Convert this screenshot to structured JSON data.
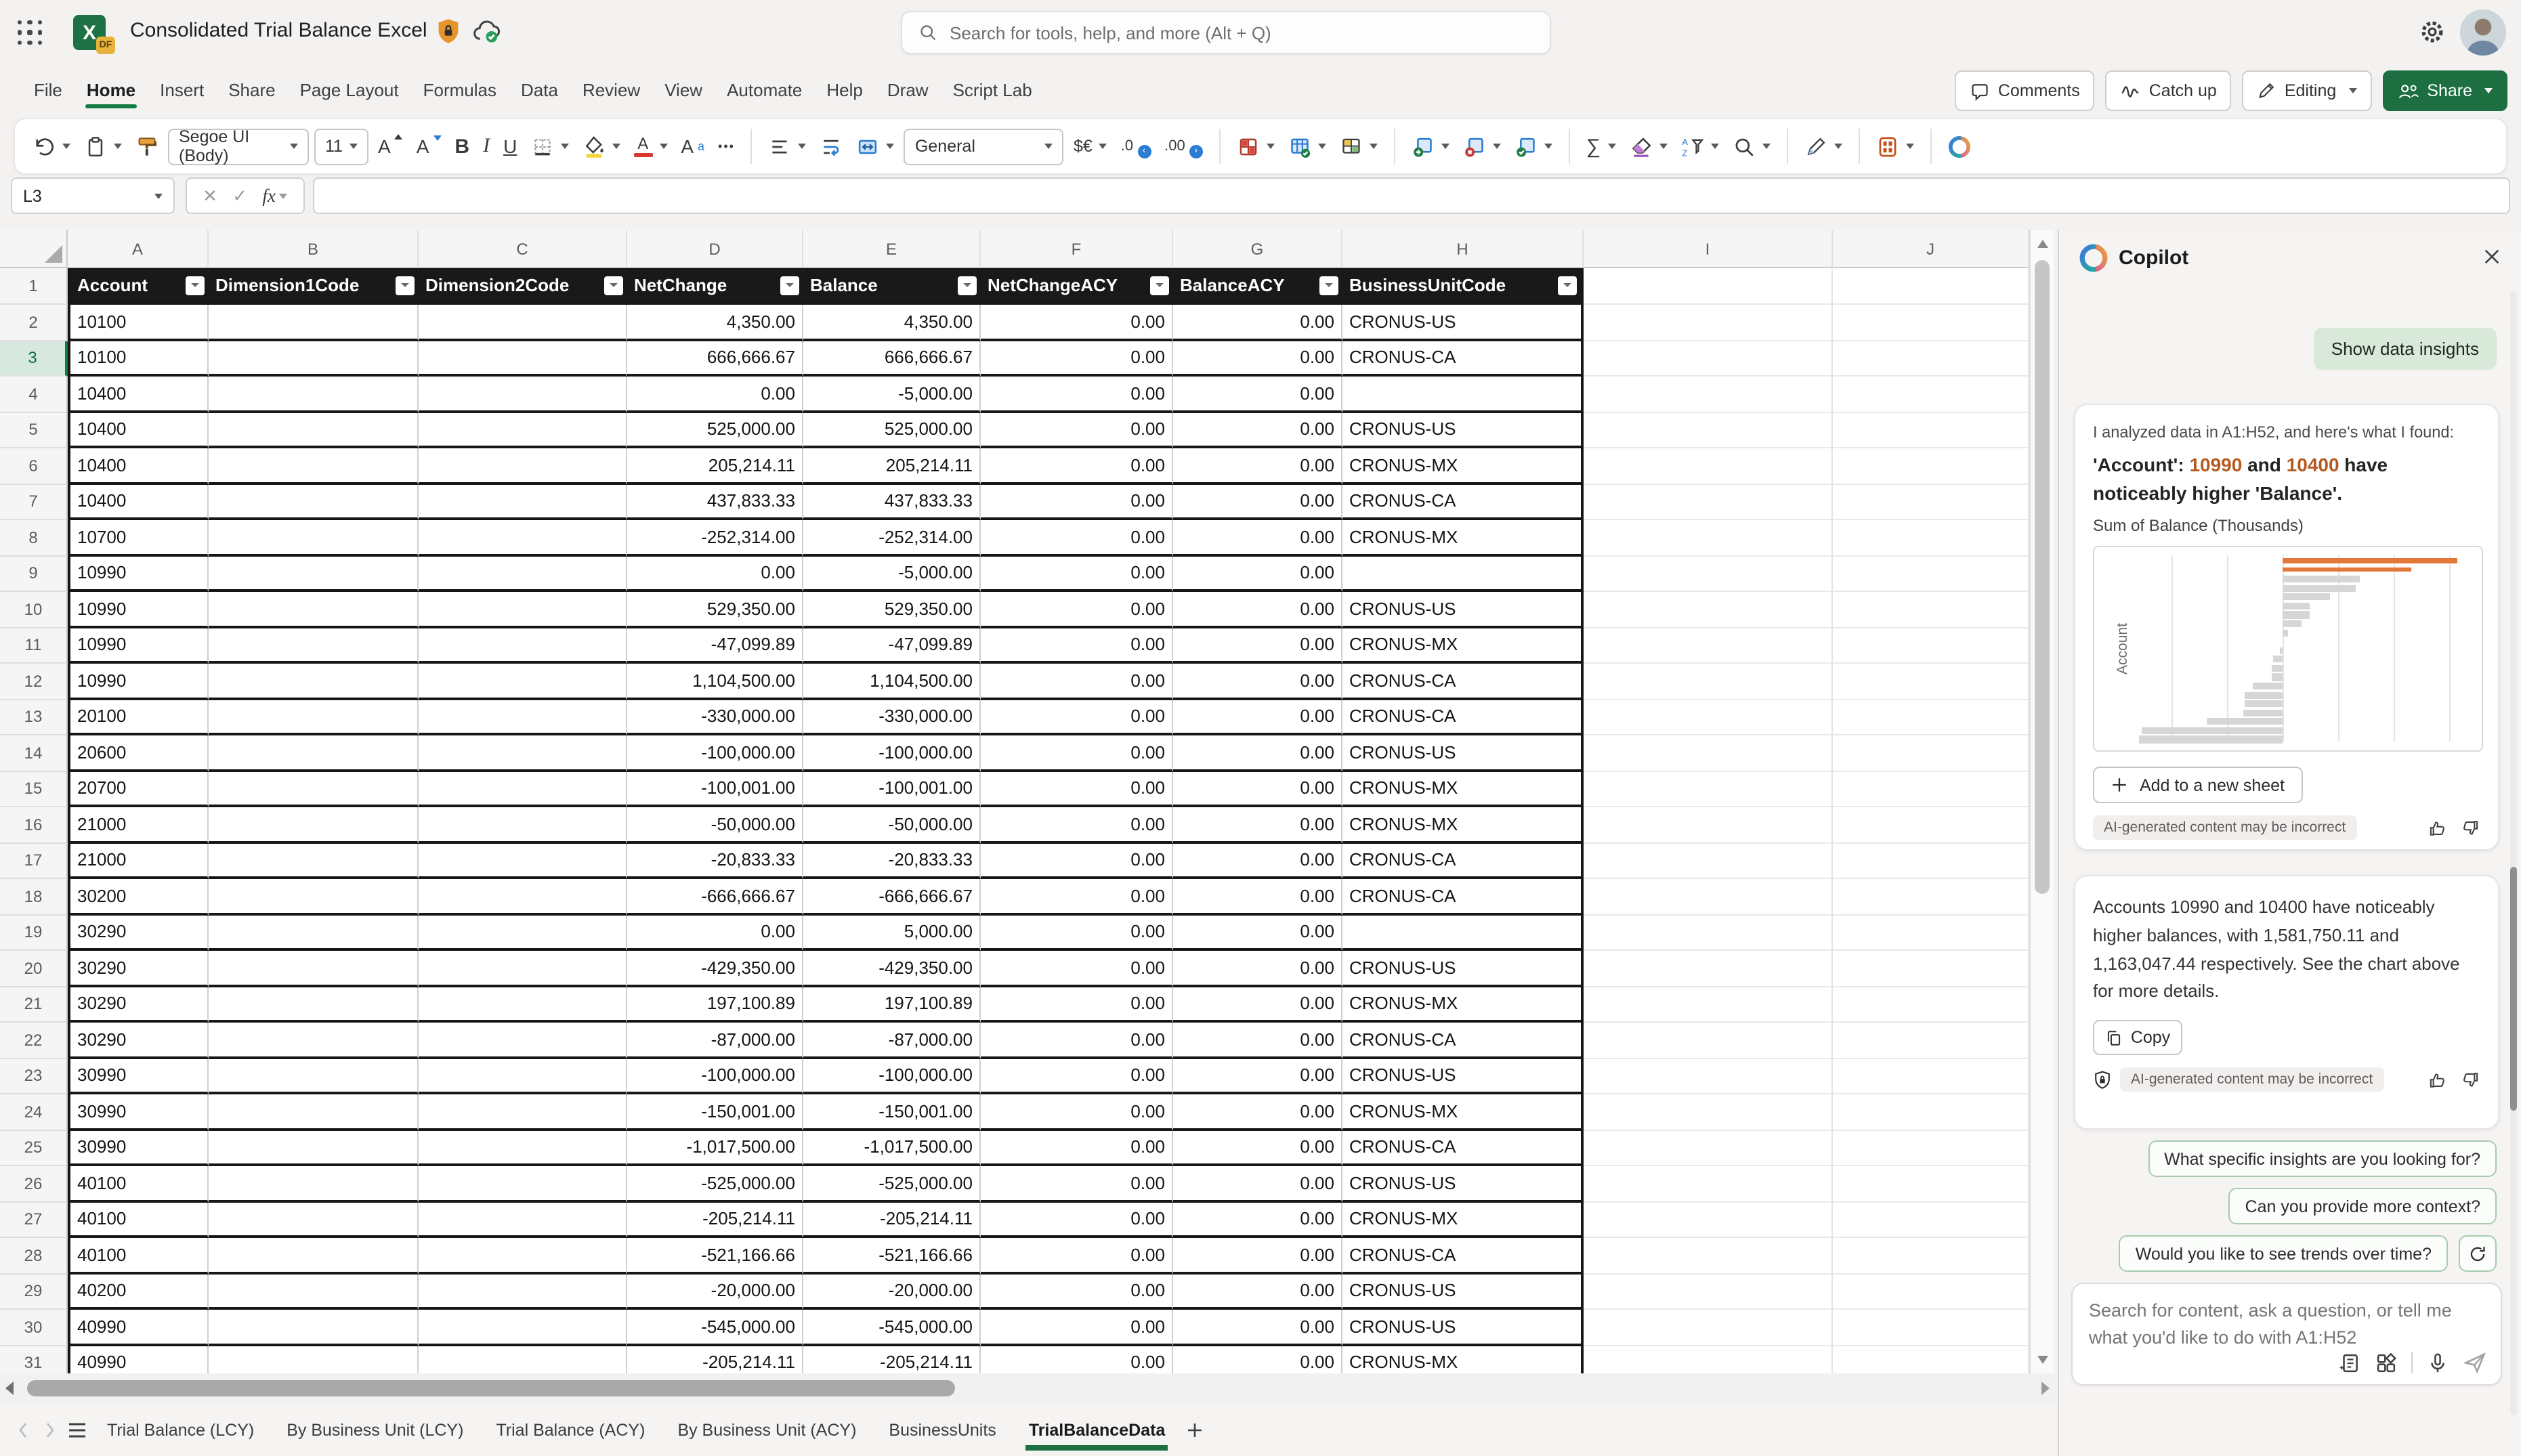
{
  "titlebar": {
    "title": "Consolidated Trial Balance Excel",
    "file_badge": "DF",
    "search_placeholder": "Search for tools, help, and more (Alt + Q)"
  },
  "menubar": {
    "items": [
      "File",
      "Home",
      "Insert",
      "Share",
      "Page Layout",
      "Formulas",
      "Data",
      "Review",
      "View",
      "Automate",
      "Help",
      "Draw",
      "Script Lab"
    ],
    "active": "Home",
    "comments_label": "Comments",
    "catchup_label": "Catch up",
    "editing_label": "Editing",
    "share_label": "Share"
  },
  "toolbar": {
    "font_name": "Segoe UI (Body)",
    "font_size": "11",
    "number_format": "General",
    "items": [
      {
        "type": "icon",
        "name": "undo",
        "caret": true
      },
      {
        "type": "icon",
        "name": "clipboard",
        "caret": true
      },
      {
        "type": "icon",
        "name": "format-painter"
      },
      {
        "type": "box",
        "name": "font-name",
        "bind": "font_name",
        "width": 104
      },
      {
        "type": "box",
        "name": "font-size",
        "bind": "font_size",
        "width": 40
      },
      {
        "type": "glyph",
        "name": "font-increase",
        "glyph": "A"
      },
      {
        "type": "glyph",
        "name": "font-decrease",
        "glyph": "A"
      },
      {
        "type": "glyph",
        "name": "bold",
        "glyph": "B"
      },
      {
        "type": "glyph",
        "name": "italic",
        "glyph": "I"
      },
      {
        "type": "glyph",
        "name": "underline",
        "glyph": "U"
      },
      {
        "type": "icon",
        "name": "borders",
        "caret": true
      },
      {
        "type": "icon",
        "name": "fill-color",
        "caret": true
      },
      {
        "type": "glyph",
        "name": "font-color",
        "glyph": "A",
        "caret": true
      },
      {
        "type": "glyph",
        "name": "text-effects",
        "glyph": "A",
        "sup": "a"
      },
      {
        "type": "glyph",
        "name": "more-formatting",
        "glyph": "•••"
      },
      {
        "type": "divider"
      },
      {
        "type": "icon",
        "name": "align",
        "caret": true
      },
      {
        "type": "icon",
        "name": "wrap-text"
      },
      {
        "type": "icon",
        "name": "merge-center",
        "caret": true
      },
      {
        "type": "box",
        "name": "number-format",
        "bind": "number_format",
        "width": 118
      },
      {
        "type": "glyph",
        "name": "currency-format",
        "glyph": "$€",
        "caret": true
      },
      {
        "type": "glyph",
        "name": "decrease-decimal",
        "glyph": ".0"
      },
      {
        "type": "glyph",
        "name": "increase-decimal",
        "glyph": ".00"
      },
      {
        "type": "divider"
      },
      {
        "type": "icon",
        "name": "conditional-formatting",
        "caret": true
      },
      {
        "type": "icon",
        "name": "format-as-table",
        "caret": true
      },
      {
        "type": "icon",
        "name": "cell-styles",
        "caret": true
      },
      {
        "type": "divider"
      },
      {
        "type": "icon",
        "name": "insert-cells",
        "caret": true
      },
      {
        "type": "icon",
        "name": "delete-cells",
        "caret": true
      },
      {
        "type": "icon",
        "name": "format-cells",
        "caret": true
      },
      {
        "type": "divider"
      },
      {
        "type": "glyph",
        "name": "autosum",
        "glyph": "∑",
        "caret": true
      },
      {
        "type": "icon",
        "name": "clear",
        "caret": true
      },
      {
        "type": "icon",
        "name": "sort-filter",
        "caret": true
      },
      {
        "type": "icon",
        "name": "find",
        "caret": true
      },
      {
        "type": "divider"
      },
      {
        "type": "icon",
        "name": "draw-tool",
        "caret": true
      },
      {
        "type": "divider"
      },
      {
        "type": "icon",
        "name": "sheet-views",
        "caret": true
      },
      {
        "type": "divider"
      },
      {
        "type": "icon",
        "name": "copilot"
      },
      {
        "type": "spacer"
      },
      {
        "type": "glyph",
        "name": "ribbon-collapse",
        "glyph": ""
      }
    ]
  },
  "formula_bar": {
    "name_box": "L3",
    "fx_label": "fx",
    "formula": ""
  },
  "grid": {
    "columns": [
      "A",
      "B",
      "C",
      "D",
      "E",
      "F",
      "G",
      "H",
      "I",
      "J"
    ],
    "table_headers": [
      "Account",
      "Dimension1Code",
      "Dimension2Code",
      "NetChange",
      "Balance",
      "NetChangeACY",
      "BalanceACY",
      "BusinessUnitCode"
    ],
    "selected_row": 3,
    "rows": [
      {
        "n": 2,
        "account": "10100",
        "net_change": "4,350.00",
        "balance": "4,350.00",
        "net_change_acy": "0.00",
        "balance_acy": "0.00",
        "business_unit": "CRONUS-US"
      },
      {
        "n": 3,
        "account": "10100",
        "net_change": "666,666.67",
        "balance": "666,666.67",
        "net_change_acy": "0.00",
        "balance_acy": "0.00",
        "business_unit": "CRONUS-CA"
      },
      {
        "n": 4,
        "account": "10400",
        "net_change": "0.00",
        "balance": "-5,000.00",
        "net_change_acy": "0.00",
        "balance_acy": "0.00",
        "business_unit": ""
      },
      {
        "n": 5,
        "account": "10400",
        "net_change": "525,000.00",
        "balance": "525,000.00",
        "net_change_acy": "0.00",
        "balance_acy": "0.00",
        "business_unit": "CRONUS-US"
      },
      {
        "n": 6,
        "account": "10400",
        "net_change": "205,214.11",
        "balance": "205,214.11",
        "net_change_acy": "0.00",
        "balance_acy": "0.00",
        "business_unit": "CRONUS-MX"
      },
      {
        "n": 7,
        "account": "10400",
        "net_change": "437,833.33",
        "balance": "437,833.33",
        "net_change_acy": "0.00",
        "balance_acy": "0.00",
        "business_unit": "CRONUS-CA"
      },
      {
        "n": 8,
        "account": "10700",
        "net_change": "-252,314.00",
        "balance": "-252,314.00",
        "net_change_acy": "0.00",
        "balance_acy": "0.00",
        "business_unit": "CRONUS-MX"
      },
      {
        "n": 9,
        "account": "10990",
        "net_change": "0.00",
        "balance": "-5,000.00",
        "net_change_acy": "0.00",
        "balance_acy": "0.00",
        "business_unit": ""
      },
      {
        "n": 10,
        "account": "10990",
        "net_change": "529,350.00",
        "balance": "529,350.00",
        "net_change_acy": "0.00",
        "balance_acy": "0.00",
        "business_unit": "CRONUS-US"
      },
      {
        "n": 11,
        "account": "10990",
        "net_change": "-47,099.89",
        "balance": "-47,099.89",
        "net_change_acy": "0.00",
        "balance_acy": "0.00",
        "business_unit": "CRONUS-MX"
      },
      {
        "n": 12,
        "account": "10990",
        "net_change": "1,104,500.00",
        "balance": "1,104,500.00",
        "net_change_acy": "0.00",
        "balance_acy": "0.00",
        "business_unit": "CRONUS-CA"
      },
      {
        "n": 13,
        "account": "20100",
        "net_change": "-330,000.00",
        "balance": "-330,000.00",
        "net_change_acy": "0.00",
        "balance_acy": "0.00",
        "business_unit": "CRONUS-CA"
      },
      {
        "n": 14,
        "account": "20600",
        "net_change": "-100,000.00",
        "balance": "-100,000.00",
        "net_change_acy": "0.00",
        "balance_acy": "0.00",
        "business_unit": "CRONUS-US"
      },
      {
        "n": 15,
        "account": "20700",
        "net_change": "-100,001.00",
        "balance": "-100,001.00",
        "net_change_acy": "0.00",
        "balance_acy": "0.00",
        "business_unit": "CRONUS-MX"
      },
      {
        "n": 16,
        "account": "21000",
        "net_change": "-50,000.00",
        "balance": "-50,000.00",
        "net_change_acy": "0.00",
        "balance_acy": "0.00",
        "business_unit": "CRONUS-MX"
      },
      {
        "n": 17,
        "account": "21000",
        "net_change": "-20,833.33",
        "balance": "-20,833.33",
        "net_change_acy": "0.00",
        "balance_acy": "0.00",
        "business_unit": "CRONUS-CA"
      },
      {
        "n": 18,
        "account": "30200",
        "net_change": "-666,666.67",
        "balance": "-666,666.67",
        "net_change_acy": "0.00",
        "balance_acy": "0.00",
        "business_unit": "CRONUS-CA"
      },
      {
        "n": 19,
        "account": "30290",
        "net_change": "0.00",
        "balance": "5,000.00",
        "net_change_acy": "0.00",
        "balance_acy": "0.00",
        "business_unit": ""
      },
      {
        "n": 20,
        "account": "30290",
        "net_change": "-429,350.00",
        "balance": "-429,350.00",
        "net_change_acy": "0.00",
        "balance_acy": "0.00",
        "business_unit": "CRONUS-US"
      },
      {
        "n": 21,
        "account": "30290",
        "net_change": "197,100.89",
        "balance": "197,100.89",
        "net_change_acy": "0.00",
        "balance_acy": "0.00",
        "business_unit": "CRONUS-MX"
      },
      {
        "n": 22,
        "account": "30290",
        "net_change": "-87,000.00",
        "balance": "-87,000.00",
        "net_change_acy": "0.00",
        "balance_acy": "0.00",
        "business_unit": "CRONUS-CA"
      },
      {
        "n": 23,
        "account": "30990",
        "net_change": "-100,000.00",
        "balance": "-100,000.00",
        "net_change_acy": "0.00",
        "balance_acy": "0.00",
        "business_unit": "CRONUS-US"
      },
      {
        "n": 24,
        "account": "30990",
        "net_change": "-150,001.00",
        "balance": "-150,001.00",
        "net_change_acy": "0.00",
        "balance_acy": "0.00",
        "business_unit": "CRONUS-MX"
      },
      {
        "n": 25,
        "account": "30990",
        "net_change": "-1,017,500.00",
        "balance": "-1,017,500.00",
        "net_change_acy": "0.00",
        "balance_acy": "0.00",
        "business_unit": "CRONUS-CA"
      },
      {
        "n": 26,
        "account": "40100",
        "net_change": "-525,000.00",
        "balance": "-525,000.00",
        "net_change_acy": "0.00",
        "balance_acy": "0.00",
        "business_unit": "CRONUS-US"
      },
      {
        "n": 27,
        "account": "40100",
        "net_change": "-205,214.11",
        "balance": "-205,214.11",
        "net_change_acy": "0.00",
        "balance_acy": "0.00",
        "business_unit": "CRONUS-MX"
      },
      {
        "n": 28,
        "account": "40100",
        "net_change": "-521,166.66",
        "balance": "-521,166.66",
        "net_change_acy": "0.00",
        "balance_acy": "0.00",
        "business_unit": "CRONUS-CA"
      },
      {
        "n": 29,
        "account": "40200",
        "net_change": "-20,000.00",
        "balance": "-20,000.00",
        "net_change_acy": "0.00",
        "balance_acy": "0.00",
        "business_unit": "CRONUS-US"
      },
      {
        "n": 30,
        "account": "40990",
        "net_change": "-545,000.00",
        "balance": "-545,000.00",
        "net_change_acy": "0.00",
        "balance_acy": "0.00",
        "business_unit": "CRONUS-US"
      },
      {
        "n": 31,
        "account": "40990",
        "net_change": "-205,214.11",
        "balance": "-205,214.11",
        "net_change_acy": "0.00",
        "balance_acy": "0.00",
        "business_unit": "CRONUS-MX"
      }
    ]
  },
  "sheet_tabs": {
    "tabs": [
      "Trial Balance (LCY)",
      "By Business Unit (LCY)",
      "Trial Balance (ACY)",
      "By Business Unit (ACY)",
      "BusinessUnits",
      "TrialBalanceData"
    ],
    "active": "TrialBalanceData",
    "add_label": "+"
  },
  "copilot": {
    "title": "Copilot",
    "insights_chip": "Show data insights",
    "card1": {
      "intro": "I analyzed data in A1:H52, and here's what I found:",
      "heading_pre": "'Account': ",
      "heading_hl1": "10990",
      "heading_mid": " and ",
      "heading_hl2": "10400",
      "heading_post": " have noticeably higher 'Balance'.",
      "chart_caption": "Sum of Balance (Thousands)",
      "add_button": "Add to a new sheet",
      "ai_note": "AI-generated content may be incorrect"
    },
    "card2": {
      "text": "Accounts 10990 and 10400 have noticeably higher balances, with 1,581,750.11 and 1,163,047.44 respectively. See the chart above for more details.",
      "copy_button": "Copy",
      "ai_note": "AI-generated content may be incorrect"
    },
    "chips": [
      "What specific insights are you looking for?",
      "Can you provide more context?",
      "Would you like to see trends over time?"
    ],
    "input_placeholder": "Search for content, ask a question, or tell me what you'd like to do with A1:H52"
  },
  "chart_data": {
    "type": "bar",
    "orientation": "horizontal",
    "title": "Sum of Balance (Thousands)",
    "ylabel": "Account",
    "xlim_thousands": [
      -1400,
      1700
    ],
    "gridline_step_thousands": 500,
    "grid": true,
    "highlight_color": "#E2793A",
    "bar_color": "#D6D6D6",
    "highlighted_accounts": [
      {
        "account": "10990",
        "sum_balance": 1581750.11
      },
      {
        "account": "10400",
        "sum_balance": 1163047.44
      }
    ],
    "bars": [
      {
        "value": 1581.75,
        "highlight": true
      },
      {
        "value": 1163.05,
        "highlight": true
      },
      {
        "value": 700,
        "highlight": false
      },
      {
        "value": 660,
        "highlight": false
      },
      {
        "value": 430,
        "highlight": false
      },
      {
        "value": 250,
        "highlight": false
      },
      {
        "value": 245,
        "highlight": false
      },
      {
        "value": 180,
        "highlight": false
      },
      {
        "value": 55,
        "highlight": false
      },
      {
        "value": 0,
        "highlight": false
      },
      {
        "value": -25,
        "highlight": false
      },
      {
        "value": -85,
        "highlight": false
      },
      {
        "value": -100,
        "highlight": false
      },
      {
        "value": -100,
        "highlight": false
      },
      {
        "value": -265,
        "highlight": false
      },
      {
        "value": -335,
        "highlight": false
      },
      {
        "value": -335,
        "highlight": false
      },
      {
        "value": -350,
        "highlight": false
      },
      {
        "value": -685,
        "highlight": false
      },
      {
        "value": -1270,
        "highlight": false
      },
      {
        "value": -1290,
        "highlight": false
      }
    ]
  }
}
